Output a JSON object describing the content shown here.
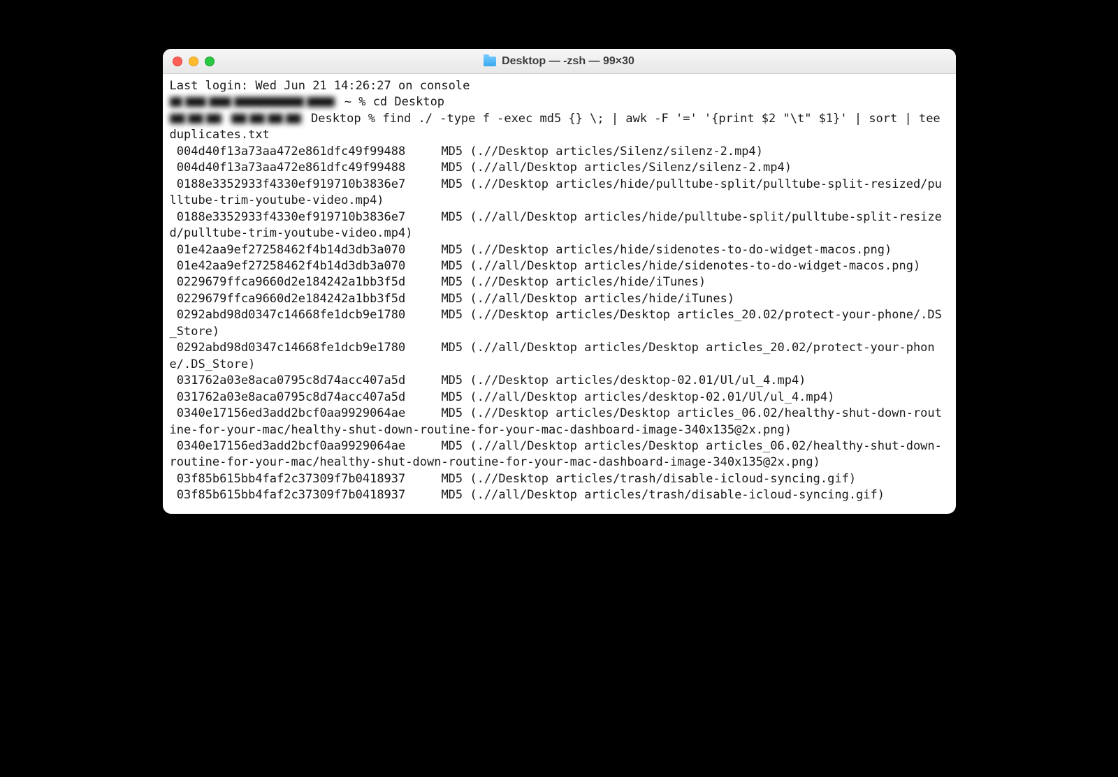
{
  "window": {
    "title": "Desktop — -zsh — 99×30"
  },
  "terminal": {
    "last_login": "Last login: Wed Jun 21 14:26:27 on console",
    "prompt1_suffix": " ~ % ",
    "cmd1": "cd Desktop",
    "prompt2_suffix": " Desktop % ",
    "cmd2": "find ./ -type f -exec md5 {} \\; | awk -F '=' '{print $2 \"\\t\" $1}' | sort | tee duplicates.txt",
    "lines": [
      " 004d40f13a73aa472e861dfc49f99488     MD5 (.//Desktop articles/Silenz/silenz-2.mp4)",
      " 004d40f13a73aa472e861dfc49f99488     MD5 (.//all/Desktop articles/Silenz/silenz-2.mp4)",
      " 0188e3352933f4330ef919710b3836e7     MD5 (.//Desktop articles/hide/pulltube-split/pulltube-split-resized/pulltube-trim-youtube-video.mp4)",
      " 0188e3352933f4330ef919710b3836e7     MD5 (.//all/Desktop articles/hide/pulltube-split/pulltube-split-resized/pulltube-trim-youtube-video.mp4)",
      " 01e42aa9ef27258462f4b14d3db3a070     MD5 (.//Desktop articles/hide/sidenotes-to-do-widget-macos.png)",
      " 01e42aa9ef27258462f4b14d3db3a070     MD5 (.//all/Desktop articles/hide/sidenotes-to-do-widget-macos.png)",
      " 0229679ffca9660d2e184242a1bb3f5d     MD5 (.//Desktop articles/hide/iTunes)",
      " 0229679ffca9660d2e184242a1bb3f5d     MD5 (.//all/Desktop articles/hide/iTunes)",
      " 0292abd98d0347c14668fe1dcb9e1780     MD5 (.//Desktop articles/Desktop articles_20.02/protect-your-phone/.DS_Store)",
      " 0292abd98d0347c14668fe1dcb9e1780     MD5 (.//all/Desktop articles/Desktop articles_20.02/protect-your-phone/.DS_Store)",
      " 031762a03e8aca0795c8d74acc407a5d     MD5 (.//Desktop articles/desktop-02.01/Ul/ul_4.mp4)",
      " 031762a03e8aca0795c8d74acc407a5d     MD5 (.//all/Desktop articles/desktop-02.01/Ul/ul_4.mp4)",
      " 0340e17156ed3add2bcf0aa9929064ae     MD5 (.//Desktop articles/Desktop articles_06.02/healthy-shut-down-routine-for-your-mac/healthy-shut-down-routine-for-your-mac-dashboard-image-340x135@2x.png)",
      " 0340e17156ed3add2bcf0aa9929064ae     MD5 (.//all/Desktop articles/Desktop articles_06.02/healthy-shut-down-routine-for-your-mac/healthy-shut-down-routine-for-your-mac-dashboard-image-340x135@2x.png)",
      " 03f85b615bb4faf2c37309f7b0418937     MD5 (.//Desktop articles/trash/disable-icloud-syncing.gif)",
      " 03f85b615bb4faf2c37309f7b0418937     MD5 (.//all/Desktop articles/trash/disable-icloud-syncing.gif)"
    ]
  }
}
